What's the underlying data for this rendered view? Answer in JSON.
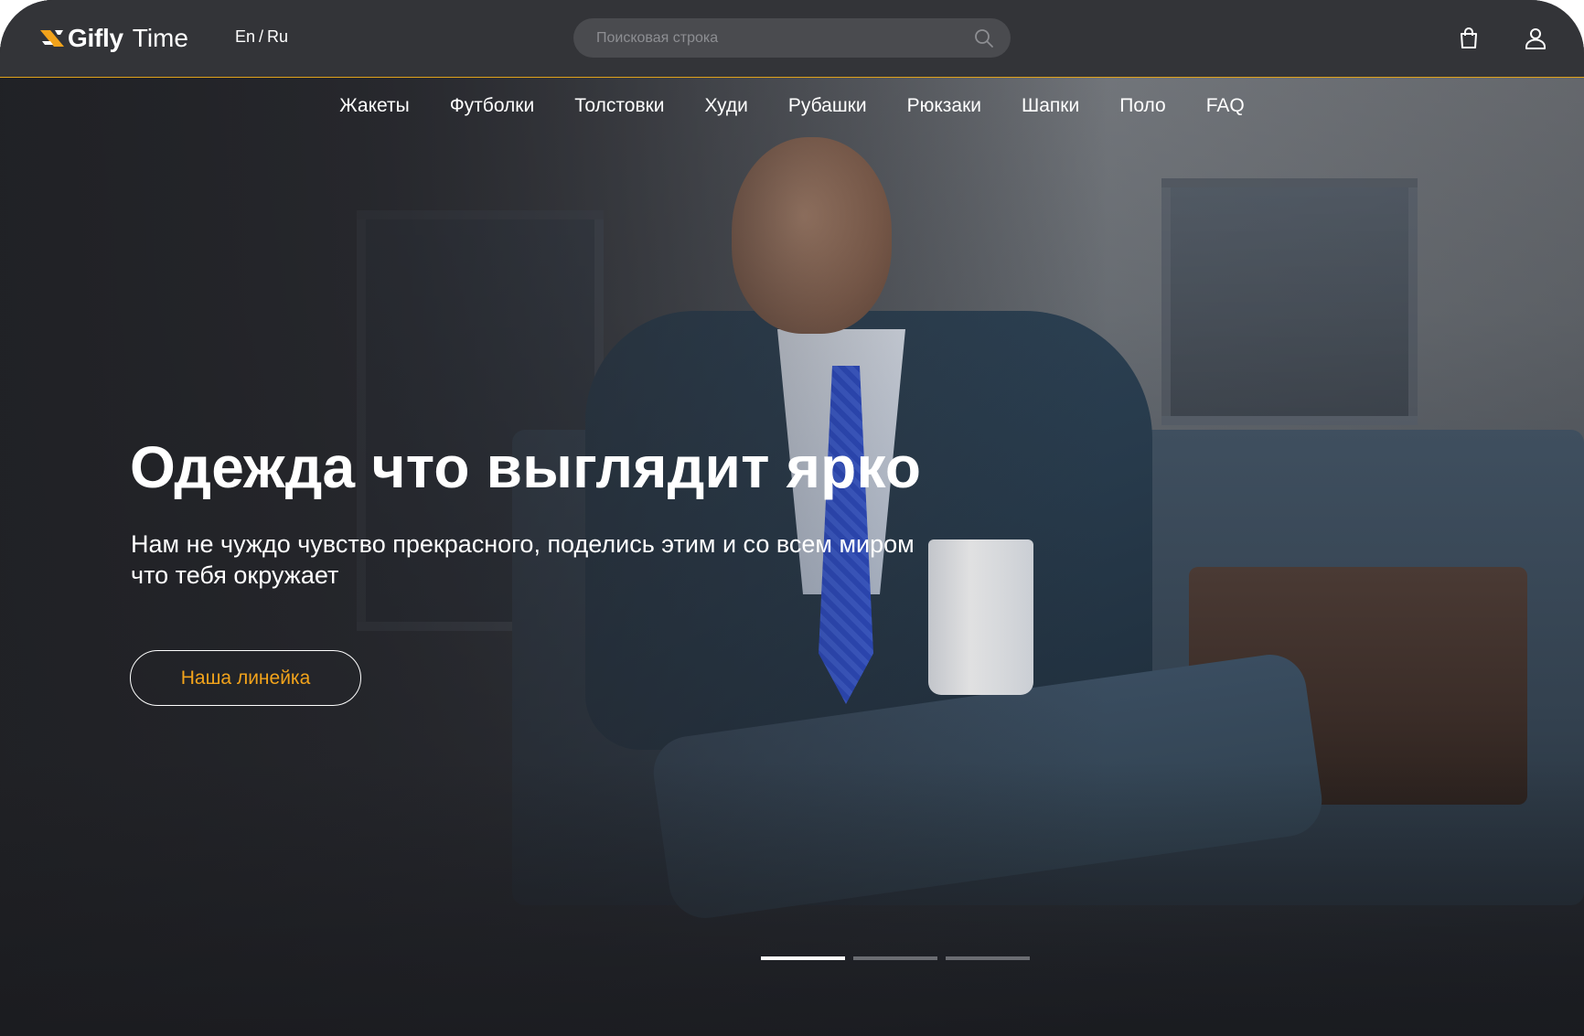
{
  "brand": {
    "name_bold": "Gifly",
    "name_light": "Time",
    "accent_color": "#e0a21a",
    "logo_icon": "ribbon-logo-icon"
  },
  "language": {
    "en": "En",
    "separator": "/",
    "ru": "Ru"
  },
  "search": {
    "placeholder": "Поисковая строка",
    "icon": "search-icon"
  },
  "header_icons": {
    "cart": "shopping-bag-icon",
    "profile": "user-icon"
  },
  "nav": {
    "items": [
      {
        "label": "Жакеты"
      },
      {
        "label": "Футболки"
      },
      {
        "label": "Толстовки"
      },
      {
        "label": "Худи"
      },
      {
        "label": "Рубашки"
      },
      {
        "label": "Рюкзаки"
      },
      {
        "label": "Шапки"
      },
      {
        "label": "Поло"
      },
      {
        "label": "FAQ"
      }
    ]
  },
  "hero": {
    "title": "Одежда что выглядит ярко",
    "subtitle": "Нам не чуждо чувство прекрасного, поделись этим и со всем миром что тебя окружает",
    "cta_label": "Наша линейка",
    "cta_color": "#f2a31b"
  },
  "slider": {
    "count": 3,
    "active_index": 0
  }
}
